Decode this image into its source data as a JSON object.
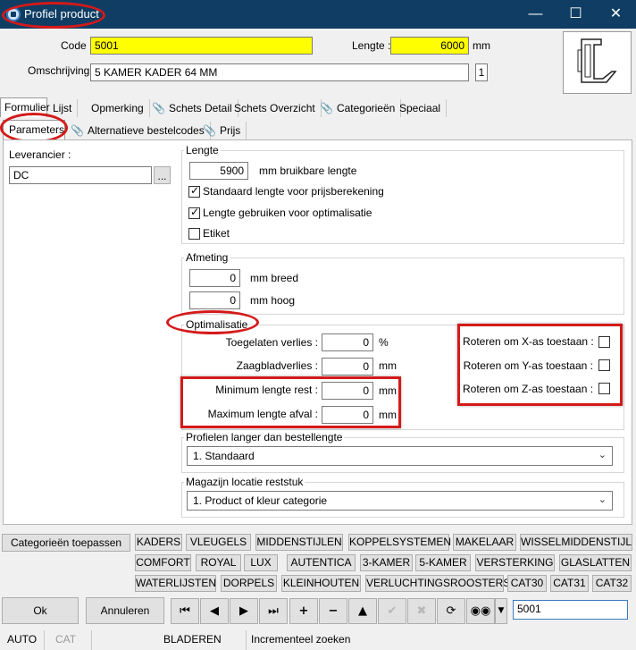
{
  "window": {
    "title": "Profiel product"
  },
  "header": {
    "code_label": "Code :",
    "code_value": "5001",
    "lengte_label": "Lengte :",
    "lengte_value": "6000",
    "lengte_unit": "mm",
    "omschrijving_label": "Omschrijving :",
    "omschrijving_value": "5 KAMER KADER 64 MM",
    "omschrijving_badge": "1"
  },
  "tabs_main": [
    "Formulier",
    "Lijst",
    "Opmerking",
    "Schets Detail",
    "Schets Overzicht",
    "Categorieën",
    "Speciaal"
  ],
  "tabs_sub": [
    "Parameters",
    "Alternatieve bestelcodes",
    "Prijs"
  ],
  "left": {
    "leverancier_label": "Leverancier :",
    "leverancier_value": "DC",
    "browse": "..."
  },
  "lengte_group": {
    "title": "Lengte",
    "value": "5900",
    "unit": "mm bruikbare lengte",
    "cb1": "Standaard lengte voor prijsberekening",
    "cb2": "Lengte gebruiken voor optimalisatie",
    "cb3": "Etiket",
    "cb1_checked": true,
    "cb2_checked": true,
    "cb3_checked": false
  },
  "afmeting_group": {
    "title": "Afmeting",
    "breed_value": "0",
    "breed_unit": "mm breed",
    "hoog_value": "0",
    "hoog_unit": "mm hoog"
  },
  "optimalisatie_group": {
    "title": "Optimalisatie",
    "verlies_label": "Toegelaten verlies :",
    "verlies_value": "0",
    "verlies_unit": "%",
    "zaagblad_label": "Zaagbladverlies :",
    "zaagblad_value": "0",
    "zaagblad_unit": "mm",
    "minrest_label": "Minimum lengte rest :",
    "minrest_value": "0",
    "minrest_unit": "mm",
    "maxafval_label": "Maximum lengte afval :",
    "maxafval_value": "0",
    "maxafval_unit": "mm",
    "rot_x": "Roteren om X-as toestaan :",
    "rot_y": "Roteren om Y-as toestaan :",
    "rot_z": "Roteren om Z-as toestaan :"
  },
  "profielen_group": {
    "title": "Profielen langer dan bestellengte",
    "value": "1.  Standaard"
  },
  "magazijn_group": {
    "title": "Magazijn locatie reststuk",
    "value": "1.  Product of kleur categorie"
  },
  "categories": {
    "apply": "Categorieën toepassen",
    "row1": [
      "KADERS",
      "VLEUGELS",
      "MIDDENSTIJLEN",
      "KOPPELSYSTEMEN",
      "MAKELAAR",
      "WISSELMIDDENSTIJL"
    ],
    "row2": [
      "COMFORT",
      "ROYAL",
      "LUX",
      "AUTENTICA",
      "3-KAMER",
      "5-KAMER",
      "VERSTERKING",
      "GLASLATTEN"
    ],
    "row3": [
      "WATERLIJSTEN",
      "DORPELS",
      "KLEINHOUTEN",
      "VERLUCHTINGSROOSTERS",
      "CAT30",
      "CAT31",
      "CAT32"
    ]
  },
  "footer": {
    "ok": "Ok",
    "annuleren": "Annuleren",
    "search_value": "5001"
  },
  "status": [
    "AUTO",
    "CAT",
    "BLADEREN",
    "Incrementeel zoeken"
  ]
}
